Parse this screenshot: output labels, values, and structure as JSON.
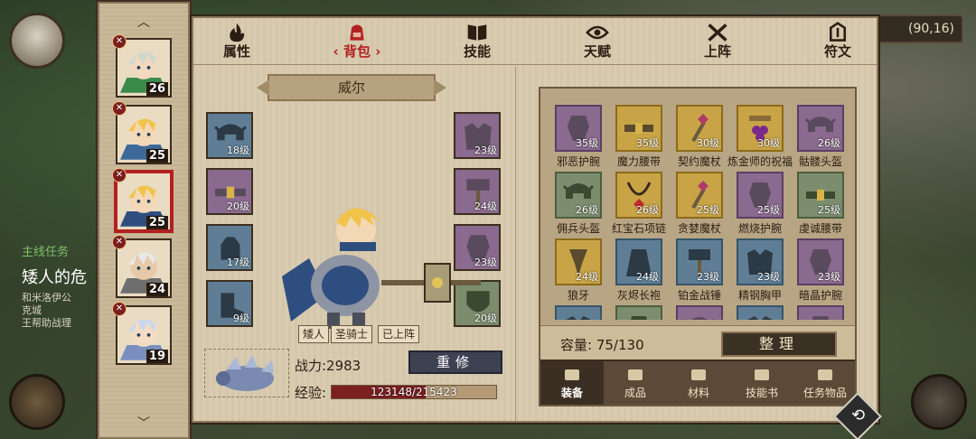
{
  "background": {
    "coords": "(90,16)",
    "quest": {
      "type": "主线任务",
      "title": "矮人的危",
      "desc_lines": [
        "和米洛伊公",
        "克城",
        "王帮助战理"
      ]
    }
  },
  "heroes": [
    {
      "level": "26",
      "badge": "✕",
      "hair": "#cfd8d0",
      "skin": "#f0d9bf",
      "cloth": "#3a8a4a"
    },
    {
      "level": "25",
      "badge": "✕",
      "hair": "#f2c34a",
      "skin": "#f3d8b6",
      "cloth": "#3d6a9a"
    },
    {
      "level": "25",
      "badge": "✕",
      "hair": "#f2c34a",
      "skin": "#f3d8b6",
      "cloth": "#2f4e80",
      "selected": true
    },
    {
      "level": "24",
      "badge": "✕",
      "hair": "#e8e8e8",
      "skin": "#e6c9a8",
      "cloth": "#6e6e6e"
    },
    {
      "level": "19",
      "badge": "✕",
      "hair": "#c9d6ef",
      "skin": "#f4dcc3",
      "cloth": "#7a8fbf"
    }
  ],
  "tabs": [
    {
      "label": "属性",
      "icon": "flame-icon"
    },
    {
      "label": "背包",
      "icon": "backpack-icon",
      "active": true
    },
    {
      "label": "技能",
      "icon": "book-icon"
    },
    {
      "label": "天赋",
      "icon": "eye-icon"
    },
    {
      "label": "上阵",
      "icon": "crossed-swords-icon"
    },
    {
      "label": "符文",
      "icon": "rune-icon"
    }
  ],
  "character": {
    "name": "威尔",
    "tags": [
      "矮人",
      "圣骑士",
      "已上阵"
    ],
    "power_label": "战力:2983",
    "repair_label": "重修",
    "exp_label": "经验:",
    "exp_text": "123148/215423",
    "exp_current": 123148,
    "exp_max": 215423
  },
  "equip_left": [
    {
      "level": "18级",
      "color": "blue",
      "icon": "helmet-icon"
    },
    {
      "level": "20级",
      "color": "purple",
      "icon": "belt-icon"
    },
    {
      "level": "17级",
      "color": "blue",
      "icon": "gauntlet-icon"
    },
    {
      "level": "9级",
      "color": "blue",
      "icon": "boots-icon"
    }
  ],
  "equip_right": [
    {
      "level": "23级",
      "color": "purple",
      "icon": "armor-icon"
    },
    {
      "level": "24级",
      "color": "purple",
      "icon": "hammer-icon"
    },
    {
      "level": "23级",
      "color": "purple",
      "icon": "bracer-icon"
    },
    {
      "level": "20级",
      "color": "green",
      "icon": "shield-icon"
    }
  ],
  "inventory": {
    "items": [
      {
        "name": "邪恶护腕",
        "level": "35级",
        "color": "purple",
        "icon": "bracer-icon"
      },
      {
        "name": "魔力腰带",
        "level": "35级",
        "color": "gold",
        "icon": "belt-icon"
      },
      {
        "name": "契约魔杖",
        "level": "30级",
        "color": "gold",
        "icon": "wand-icon"
      },
      {
        "name": "炼金师的祝福",
        "level": "30级",
        "color": "gold",
        "icon": "grapes-icon"
      },
      {
        "name": "骷髅头盔",
        "level": "26级",
        "color": "purple",
        "icon": "helmet-icon"
      },
      {
        "name": "佣兵头盔",
        "level": "26级",
        "color": "green",
        "icon": "helmet-icon"
      },
      {
        "name": "红宝石项链",
        "level": "26级",
        "color": "gold",
        "icon": "necklace-icon"
      },
      {
        "name": "贪婪魔杖",
        "level": "25级",
        "color": "gold",
        "icon": "wand-icon"
      },
      {
        "name": "燃烧护腕",
        "level": "25级",
        "color": "purple",
        "icon": "bracer-icon"
      },
      {
        "name": "虔诚腰带",
        "level": "25级",
        "color": "green",
        "icon": "belt-icon"
      },
      {
        "name": "狼牙",
        "level": "24级",
        "color": "gold",
        "icon": "fang-icon"
      },
      {
        "name": "灰烬长袍",
        "level": "24级",
        "color": "blue",
        "icon": "robe-icon"
      },
      {
        "name": "铂金战锤",
        "level": "23级",
        "color": "blue",
        "icon": "hammer-icon"
      },
      {
        "name": "精钢胸甲",
        "level": "23级",
        "color": "blue",
        "icon": "armor-icon"
      },
      {
        "name": "暗晶护腕",
        "level": "23级",
        "color": "purple",
        "icon": "bracer-icon"
      },
      {
        "name": "",
        "level": "",
        "color": "blue",
        "icon": "armor-icon"
      },
      {
        "name": "",
        "level": "",
        "color": "green",
        "icon": "robe-icon"
      },
      {
        "name": "",
        "level": "",
        "color": "purple",
        "icon": "helmet-icon"
      },
      {
        "name": "",
        "level": "",
        "color": "blue",
        "icon": "armor-icon"
      },
      {
        "name": "",
        "level": "",
        "color": "purple",
        "icon": "bracer-icon"
      }
    ],
    "capacity_label": "容量:",
    "capacity_value": "75/130",
    "sort_label": "整理",
    "categories": [
      {
        "label": "装备",
        "icon": "hammer-crossed-icon",
        "active": true
      },
      {
        "label": "成品",
        "icon": "bag-icon"
      },
      {
        "label": "材料",
        "icon": "ingot-icon"
      },
      {
        "label": "技能书",
        "icon": "scroll-icon"
      },
      {
        "label": "任务物品",
        "icon": "quest-scroll-icon"
      }
    ]
  },
  "colors": {
    "rarity_purple": "#8a6a8e",
    "rarity_gold": "#c8a447",
    "rarity_green": "#7b8d6d",
    "rarity_blue": "#5f7e95",
    "accent_red": "#b32020"
  }
}
